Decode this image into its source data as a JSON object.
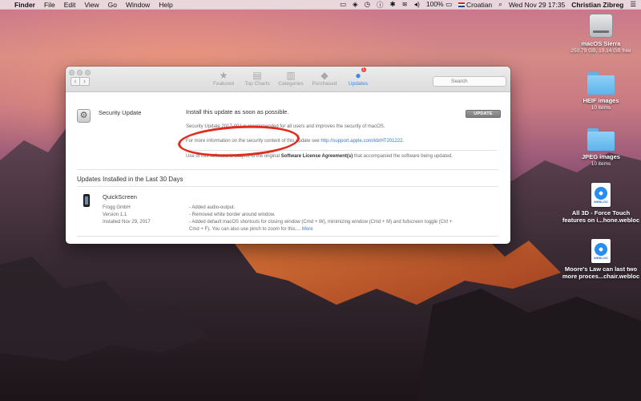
{
  "menubar": {
    "apple_glyph": "",
    "app_name": "Finder",
    "menus": [
      "File",
      "Edit",
      "View",
      "Go",
      "Window",
      "Help"
    ],
    "battery": "100%",
    "input_source": "Croatian",
    "datetime": "Wed Nov 29  17:35",
    "user": "Christian Zibreg"
  },
  "desktop": {
    "icons": [
      {
        "label": "macOS Sierra",
        "sub": "250.79 GB, 19.14 GB free",
        "kind": "hdd-icon"
      },
      {
        "label": "HEIF images",
        "sub": "10 items",
        "kind": "folder-icon"
      },
      {
        "label": "JPEG images",
        "sub": "10 items",
        "kind": "folder-icon"
      },
      {
        "label": "All 3D - Force Touch features on i...hone.webloc",
        "sub": "",
        "kind": "webloc-icon"
      },
      {
        "label": "Moore's Law can last two more proces...chair.webloc",
        "sub": "",
        "kind": "webloc-icon"
      }
    ],
    "webloc_tag": "WEBLOC"
  },
  "window": {
    "tabs": [
      {
        "label": "Featured",
        "icon": "star-icon",
        "glyph": "★"
      },
      {
        "label": "Top Charts",
        "icon": "list-icon",
        "glyph": "▤"
      },
      {
        "label": "Categories",
        "icon": "categories-icon",
        "glyph": "▥"
      },
      {
        "label": "Purchased",
        "icon": "tag-icon",
        "glyph": "◆"
      },
      {
        "label": "Updates",
        "icon": "updates-icon",
        "glyph": "●",
        "active": true,
        "badge": "1"
      }
    ],
    "search_placeholder": "Search",
    "nav_back": "‹",
    "nav_forward": "›",
    "pending_update": {
      "name": "Security Update",
      "headline": "Install this update as soon as possible.",
      "description": "Security Update 2017-001 is recommended for all users and improves the security of macOS.",
      "more_info_prefix": "For more information on the security content of this update see ",
      "more_info_link": "http://support.apple.com/kb/HT201222",
      "more_info_suffix": ".",
      "button": "UPDATE",
      "license_prefix": "Use of this software is subject to the original ",
      "license_bold": "Software License Agreement(s)",
      "license_suffix": " that accompanied the software being updated."
    },
    "installed_section_title": "Updates Installed in the Last 30 Days",
    "installed": {
      "name": "QuickScreen",
      "developer": "Frogg GmbH",
      "version": "Version 1.1",
      "installed": "Installed Nov 29, 2017",
      "notes": [
        "- Added audio-output.",
        "- Removed white border around window.",
        "- Added default macOS shortcuts for closing window (Cmd + W), minimizing window (Cmd + M) and fullscreen toggle (Ctrl + Cmd + F). You can also use pinch to zoom for this...."
      ],
      "more": "More"
    }
  },
  "colors": {
    "accent": "#3b86f0",
    "annotation": "#e02b1f",
    "link": "#3a78c6"
  }
}
